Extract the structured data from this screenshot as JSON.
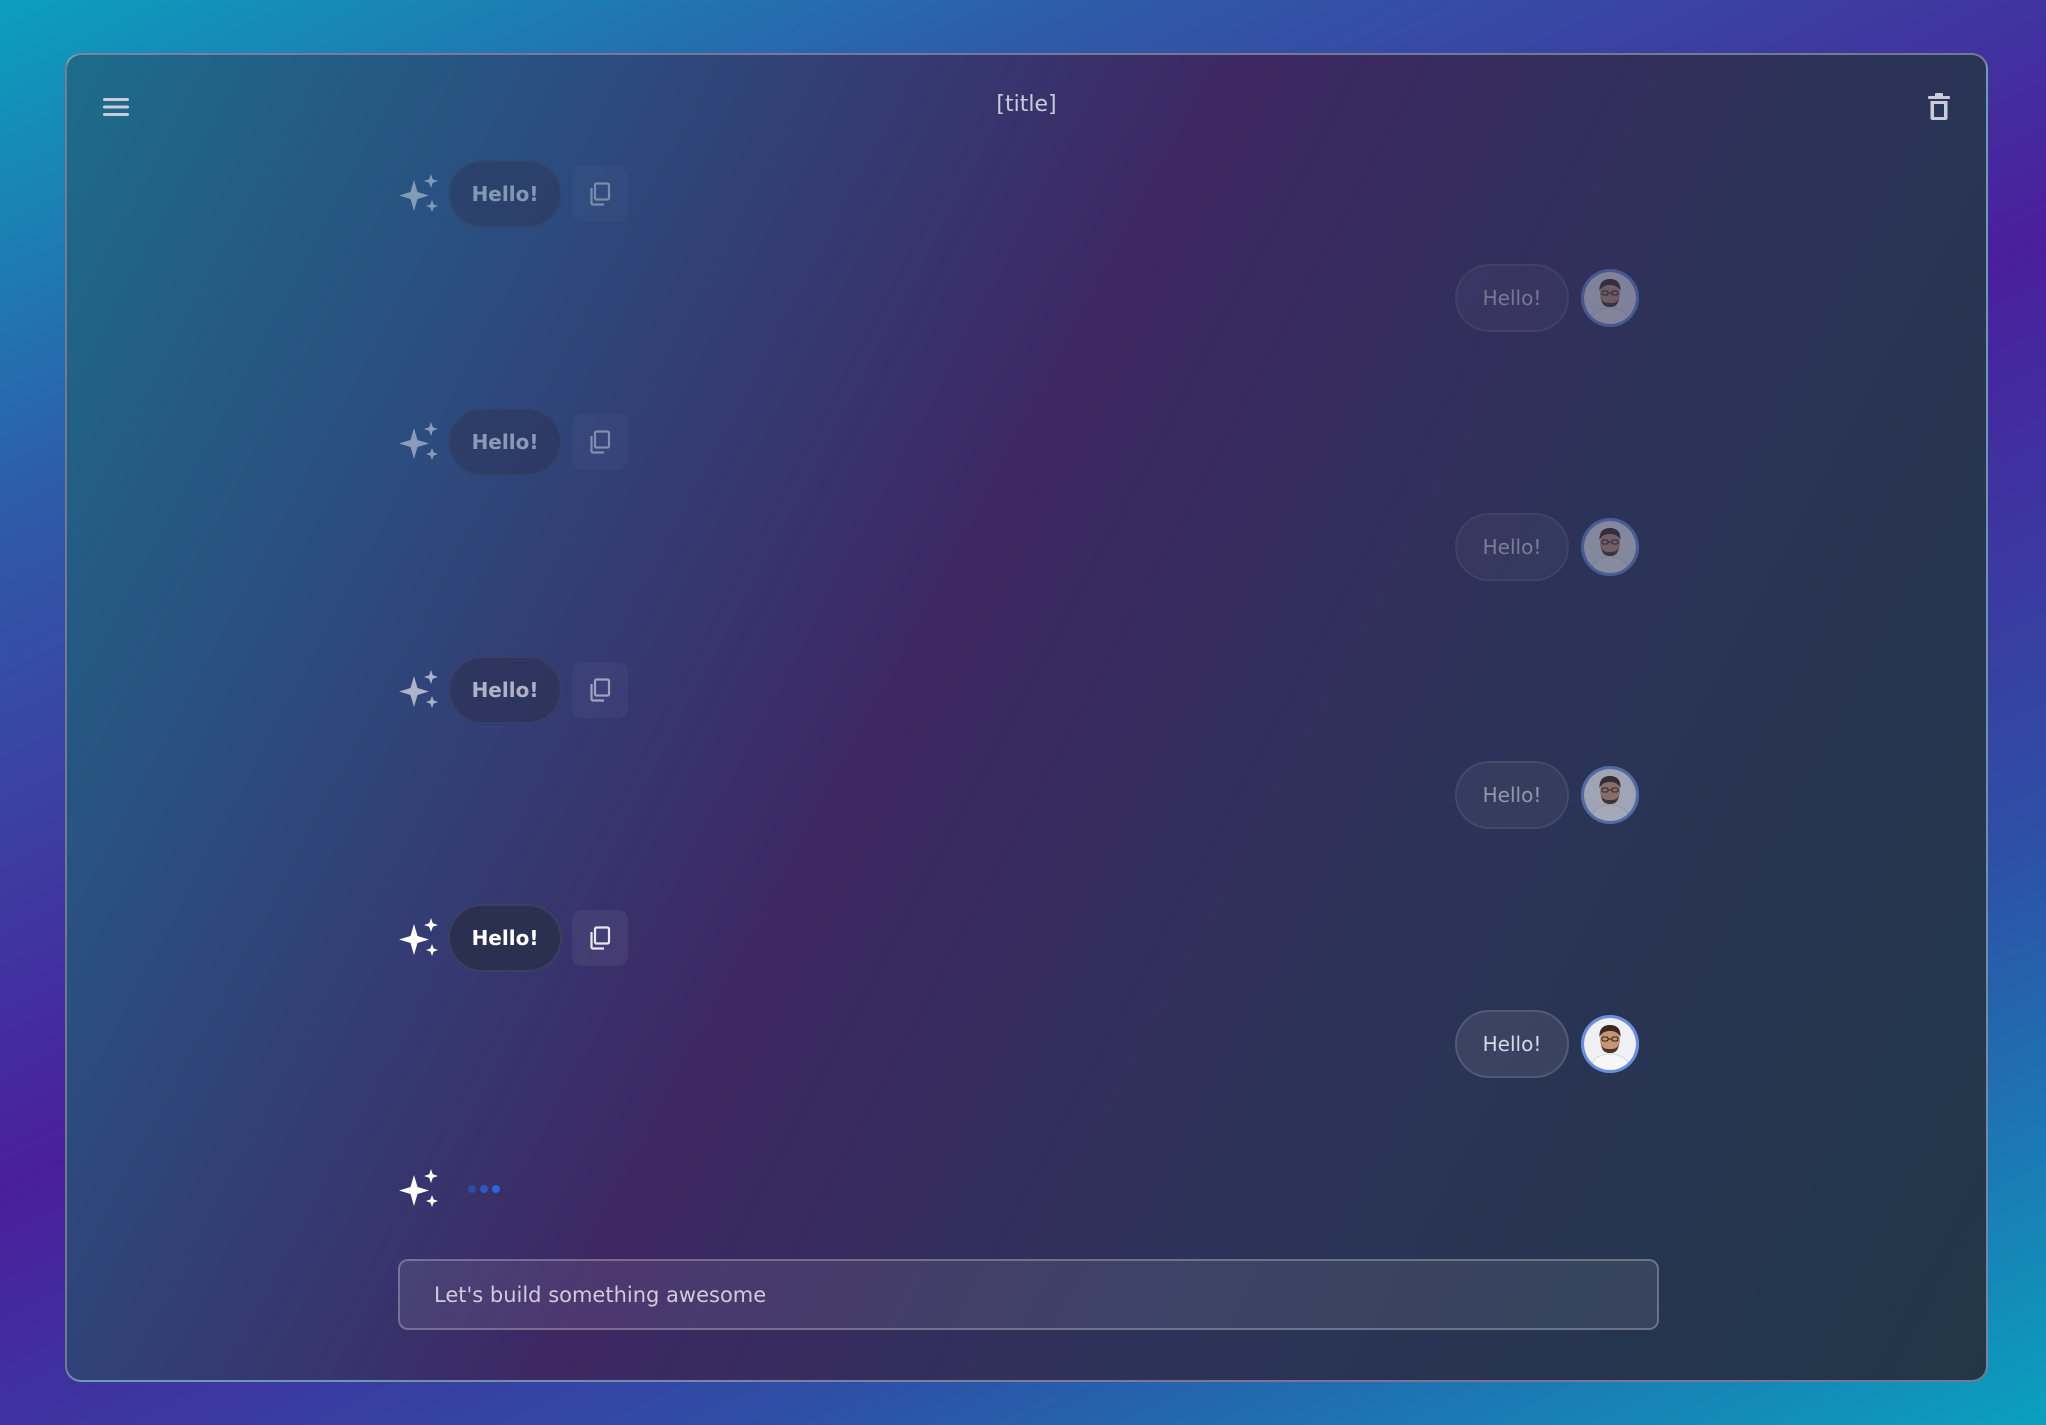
{
  "header": {
    "title": "[title]",
    "menu_icon": "hamburger-menu-icon",
    "delete_icon": "trash-icon"
  },
  "messages": [
    {
      "role": "assistant",
      "text": "Hello!"
    },
    {
      "role": "user",
      "text": "Hello!"
    },
    {
      "role": "assistant",
      "text": "Hello!"
    },
    {
      "role": "user",
      "text": "Hello!"
    },
    {
      "role": "assistant",
      "text": "Hello!"
    },
    {
      "role": "user",
      "text": "Hello!"
    },
    {
      "role": "assistant",
      "text": "Hello!"
    },
    {
      "role": "user",
      "text": "Hello!"
    }
  ],
  "typing_indicator": {
    "icon": "sparkles-icon",
    "state": "typing"
  },
  "composer": {
    "placeholder": "Let's build something awesome"
  },
  "colors": {
    "avatar_ring": "#6b8fe0",
    "typing_dot": "#2b63e0",
    "assistant_bubble": "#2c3050"
  }
}
